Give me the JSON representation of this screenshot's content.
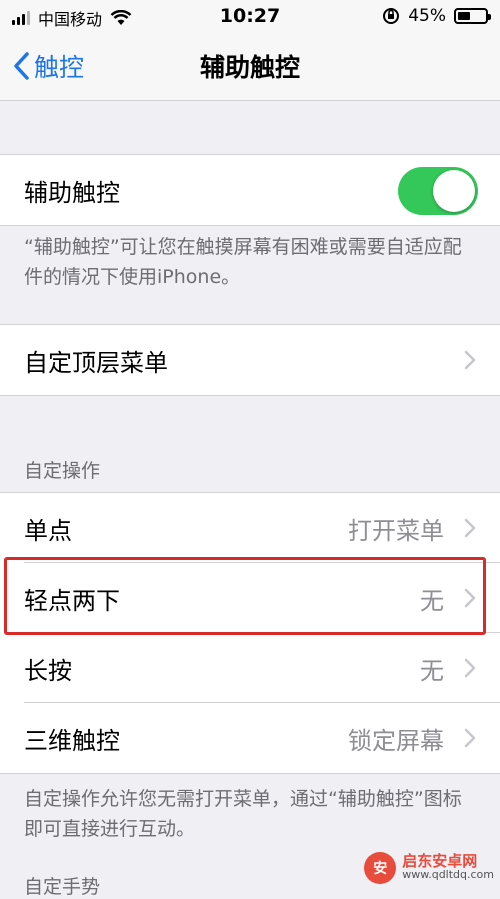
{
  "status_bar": {
    "carrier": "中国移动",
    "time": "10:27",
    "battery": "45%",
    "battery_level": 0.45
  },
  "nav": {
    "back_label": "触控",
    "title": "辅助触控"
  },
  "assistive_touch": {
    "label": "辅助触控",
    "enabled": true,
    "footer": "“辅助触控”可让您在触摸屏幕有困难或需要自适应配件的情况下使用iPhone。"
  },
  "top_menu": {
    "label": "自定顶层菜单"
  },
  "custom_actions": {
    "header": "自定操作",
    "items": [
      {
        "label": "单点",
        "value": "打开菜单"
      },
      {
        "label": "轻点两下",
        "value": "无"
      },
      {
        "label": "长按",
        "value": "无"
      },
      {
        "label": "三维触控",
        "value": "锁定屏幕"
      }
    ],
    "footer": "自定操作允许您无需打开菜单，通过“辅助触控”图标即可直接进行互动。"
  },
  "next_section": {
    "header": "自定手势"
  },
  "watermark": {
    "title": "启东安卓网",
    "url": "www.qdltdq.com"
  },
  "colors": {
    "accent": "#1f75e6",
    "toggle_on": "#34c759",
    "highlight": "#d92a2a"
  }
}
